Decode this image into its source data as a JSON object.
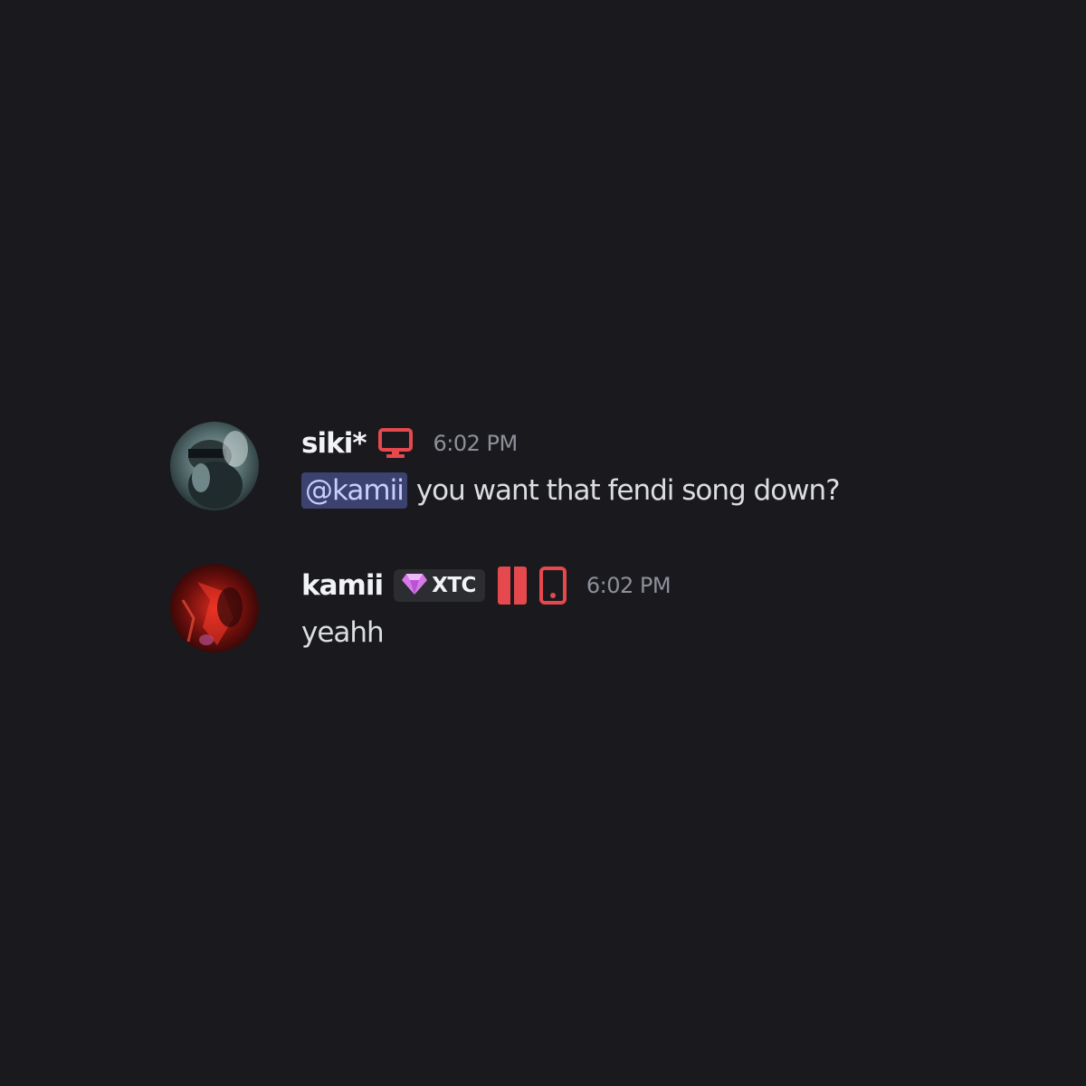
{
  "messages": [
    {
      "username": "siki*",
      "timestamp": "6:02 PM",
      "mention": "@kamii",
      "text": "you want that fendi song down?",
      "status_icons": [
        "desktop-icon"
      ]
    },
    {
      "username": "kamii",
      "timestamp": "6:02 PM",
      "tag": {
        "icon": "gem-icon",
        "label": "XTC"
      },
      "text": "yeahh",
      "status_icons": [
        "browser-icon",
        "mobile-icon"
      ]
    }
  ],
  "colors": {
    "background": "#1a1a1e",
    "status_red": "#e5484d",
    "mention_bg": "#3c4270",
    "mention_text": "#c9cdfb",
    "gem": "#d67ae8"
  }
}
